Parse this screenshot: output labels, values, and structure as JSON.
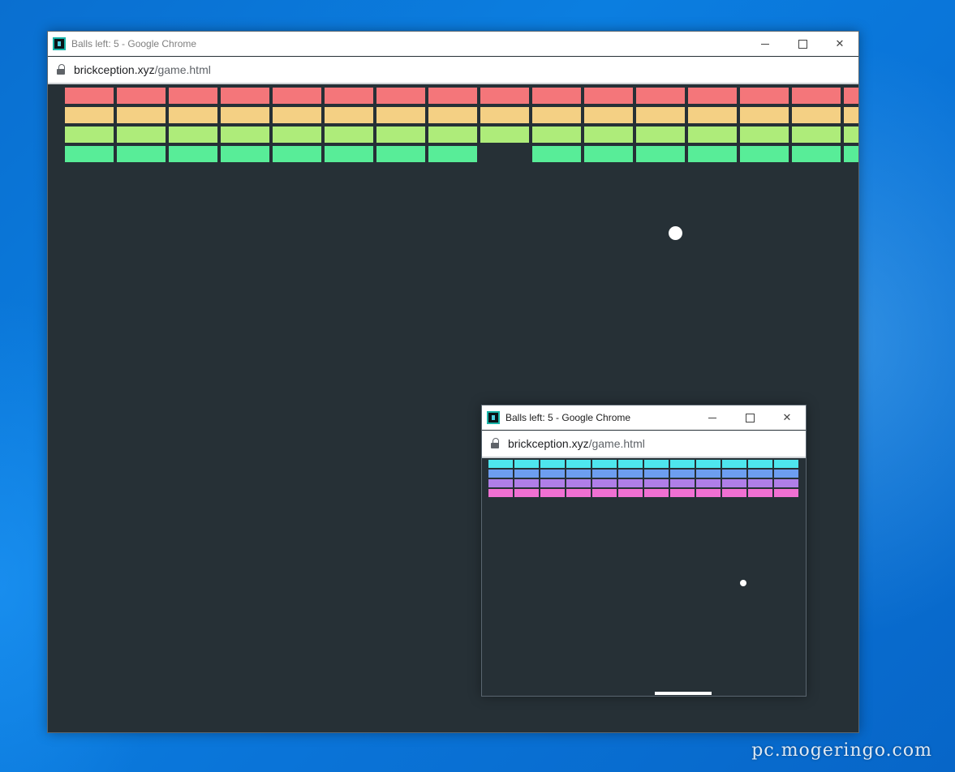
{
  "windows": {
    "large": {
      "title": "Balls left: 5 - Google Chrome",
      "url_domain": "brickception.xyz",
      "url_path": "/game.html",
      "brick_rows": [
        {
          "color": "#f4767a",
          "present": [
            1,
            1,
            1,
            1,
            1,
            1,
            1,
            1,
            1,
            1,
            1,
            1,
            1,
            1,
            1,
            1
          ]
        },
        {
          "color": "#f4d084",
          "present": [
            1,
            1,
            1,
            1,
            1,
            1,
            1,
            1,
            1,
            1,
            1,
            1,
            1,
            1,
            1,
            1
          ]
        },
        {
          "color": "#aeec7a",
          "present": [
            1,
            1,
            1,
            1,
            1,
            1,
            1,
            1,
            1,
            1,
            1,
            1,
            1,
            1,
            1,
            1
          ]
        },
        {
          "color": "#58ed98",
          "present": [
            1,
            1,
            1,
            1,
            1,
            1,
            1,
            1,
            0,
            1,
            1,
            1,
            1,
            1,
            1,
            1
          ]
        }
      ]
    },
    "small": {
      "title": "Balls left: 5 - Google Chrome",
      "url_domain": "brickception.xyz",
      "url_path": "/game.html",
      "brick_rows": [
        {
          "color": "#4ee6ee",
          "present": [
            1,
            1,
            1,
            1,
            1,
            1,
            1,
            1,
            1,
            1,
            1,
            1
          ]
        },
        {
          "color": "#6d9ef0",
          "present": [
            1,
            1,
            1,
            1,
            1,
            1,
            1,
            1,
            1,
            1,
            1,
            1
          ]
        },
        {
          "color": "#b07ee8",
          "present": [
            1,
            1,
            1,
            1,
            1,
            1,
            1,
            1,
            1,
            1,
            1,
            1
          ]
        },
        {
          "color": "#f070d2",
          "present": [
            1,
            1,
            1,
            1,
            1,
            1,
            1,
            1,
            1,
            1,
            1,
            1
          ]
        }
      ]
    }
  },
  "watermark": "pc.mogeringo.com"
}
